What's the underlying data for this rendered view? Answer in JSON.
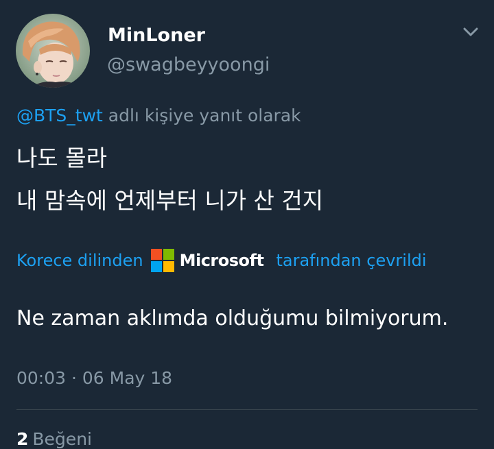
{
  "user": {
    "display_name": "MinLoner",
    "handle": "@swagbeyyoongi"
  },
  "reply": {
    "mention": "@BTS_twt",
    "suffix": " adlı kişiye yanıt olarak"
  },
  "tweet": {
    "line1": "나도 몰라",
    "line2": "내 맘속에 언제부터 니가 산 건지"
  },
  "translation": {
    "prefix": "Korece dilinden",
    "brand": "Microsoft",
    "suffix": "tarafından çevrildi",
    "text": "Ne zaman aklımda olduğumu bilmiyorum."
  },
  "meta": {
    "timestamp": "00:03 · 06 May 18"
  },
  "stats": {
    "likes_count": "2",
    "likes_label": "Beğeni"
  },
  "colors": {
    "background": "#1b2836",
    "link": "#1da1f2",
    "muted": "#8899a6"
  },
  "icons": {
    "menu": "chevron-down-icon",
    "brand_logo": "microsoft-logo-icon"
  }
}
